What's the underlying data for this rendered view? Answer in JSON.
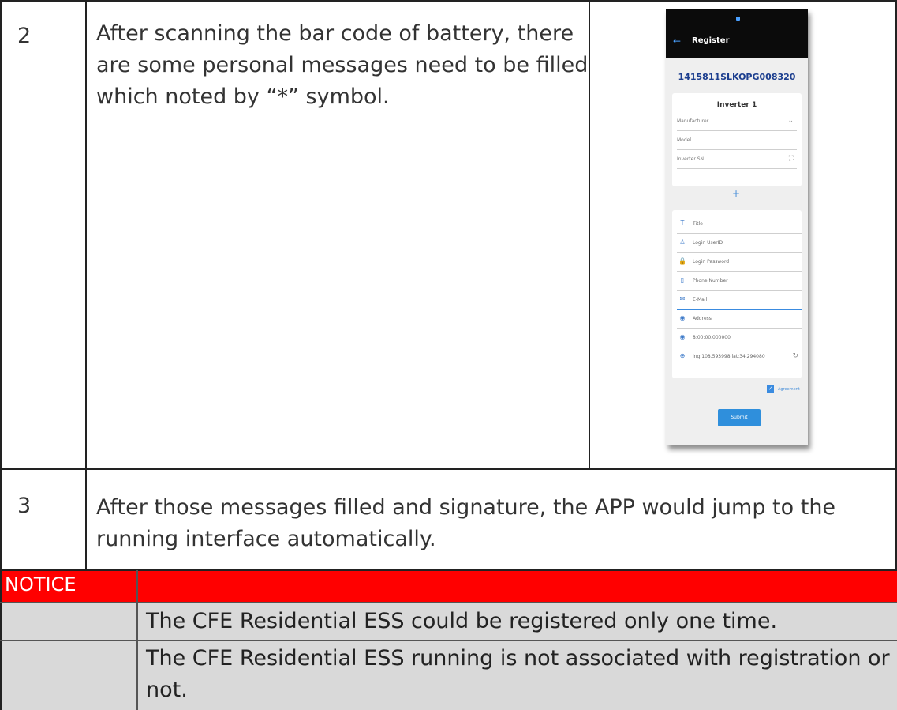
{
  "rows": [
    {
      "number": "2",
      "lines": [
        "After scanning the bar code of battery, there",
        "are some personal messages need to be filled",
        "which noted by “*” symbol."
      ]
    },
    {
      "number": "3",
      "lines": [
        "After those messages filled and signature, the APP would jump to the",
        "running interface automatically."
      ]
    }
  ],
  "notice": {
    "label": "NOTICE",
    "items": [
      {
        "lines": [
          "The CFE Residential ESS could be registered only one time."
        ]
      },
      {
        "lines": [
          "The CFE Residential ESS running is not associated with registration or",
          "not."
        ]
      }
    ]
  },
  "phone": {
    "back_icon": "arrow-left-icon",
    "title": "Register",
    "serial": "1415811SLKOPG008320",
    "inverter_card": {
      "title": "Inverter 1",
      "fields": [
        {
          "label": "Manufacturer",
          "icon": "chevron-down-icon",
          "glyph": "⌄"
        },
        {
          "label": "Model"
        },
        {
          "label": "Inverter SN",
          "icon": "scan-icon",
          "glyph": "⛶"
        }
      ]
    },
    "add_glyph": "+",
    "form_fields": [
      {
        "icon": "text-icon",
        "glyph": "T",
        "label": "Title"
      },
      {
        "icon": "user-icon",
        "glyph": "♙",
        "label": "Login UserID"
      },
      {
        "icon": "lock-icon",
        "glyph": "🔒",
        "label": "Login Password"
      },
      {
        "icon": "phone-icon",
        "glyph": "▯",
        "label": "Phone Number"
      },
      {
        "icon": "mail-icon",
        "glyph": "✉",
        "label": "E-Mail"
      },
      {
        "icon": "location-icon",
        "glyph": "◉",
        "label": "Address"
      },
      {
        "icon": "location-icon",
        "glyph": "◉",
        "label": "8:00:00.000000"
      },
      {
        "icon": "target-icon",
        "glyph": "⊕",
        "label": "lng:108.593998,lat:34.294080",
        "right_icon": "refresh-icon",
        "right_glyph": "↻"
      }
    ],
    "agreement_label": "Agreement",
    "agreement_checked": true,
    "submit_label": "Submit",
    "colors": {
      "header": "#0b0b0b",
      "accent": "#3a8be0",
      "notice_red": "#ff0000",
      "notice_gray": "#d9d9d9"
    }
  }
}
